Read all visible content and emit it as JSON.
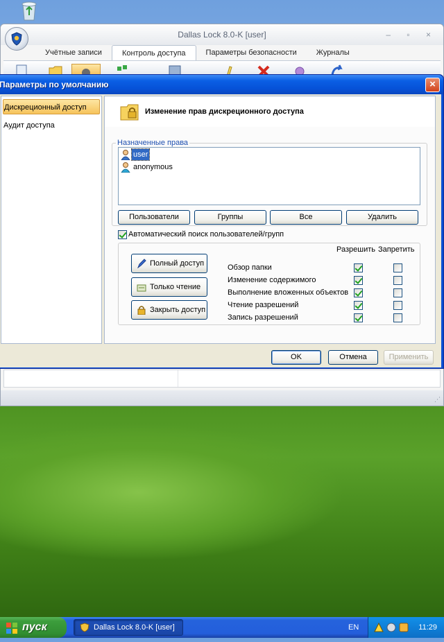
{
  "main_window": {
    "title": "Dallas Lock 8.0-K [user]",
    "controls": "–  ▫  ×",
    "tabs": [
      {
        "label": "Учётные записи",
        "active": false
      },
      {
        "label": "Контроль доступа",
        "active": true
      },
      {
        "label": "Параметры безопасности",
        "active": false
      },
      {
        "label": "Журналы",
        "active": false
      }
    ]
  },
  "dialog": {
    "title": "Параметры по умолчанию",
    "close_label": "×",
    "nav_items": [
      {
        "label": "Дискреционный доступ",
        "selected": true
      },
      {
        "label": "Аудит доступа",
        "selected": false
      }
    ],
    "header_text": "Изменение прав дискреционного доступа",
    "rights_group_label": "Назначенные права",
    "principals": [
      {
        "name": "user",
        "selected": true
      },
      {
        "name": "anonymous",
        "selected": false
      }
    ],
    "buttons": {
      "users": "Пользователи",
      "groups": "Группы",
      "all": "Все",
      "delete": "Удалить"
    },
    "auto_search": {
      "label": "Автоматический поиск пользователей/групп",
      "checked": true
    },
    "preset_buttons": {
      "full": "Полный доступ",
      "readonly": "Только чтение",
      "deny": "Закрыть доступ"
    },
    "columns": {
      "allow": "Разрешить",
      "deny": "Запретить"
    },
    "permissions": [
      {
        "name": "Обзор папки",
        "allow": true,
        "deny": false
      },
      {
        "name": "Изменение содержимого",
        "allow": true,
        "deny": false
      },
      {
        "name": "Выполнение вложенных объектов",
        "allow": true,
        "deny": false
      },
      {
        "name": "Чтение разрешений",
        "allow": true,
        "deny": false
      },
      {
        "name": "Запись разрешений",
        "allow": true,
        "deny": false
      }
    ],
    "footer": {
      "ok": "OK",
      "cancel": "Отмена",
      "apply": "Применить"
    }
  },
  "taskbar": {
    "start_label": "пуск",
    "task_title": "Dallas Lock 8.0-K [user]",
    "language": "EN",
    "clock": "11:29"
  },
  "colors": {
    "xp_title_blue": "#0652d8",
    "selection_blue": "#316ac5",
    "check_green": "#21a121",
    "start_green": "#3c9d3c",
    "nav_selected": "#f6c35b"
  }
}
